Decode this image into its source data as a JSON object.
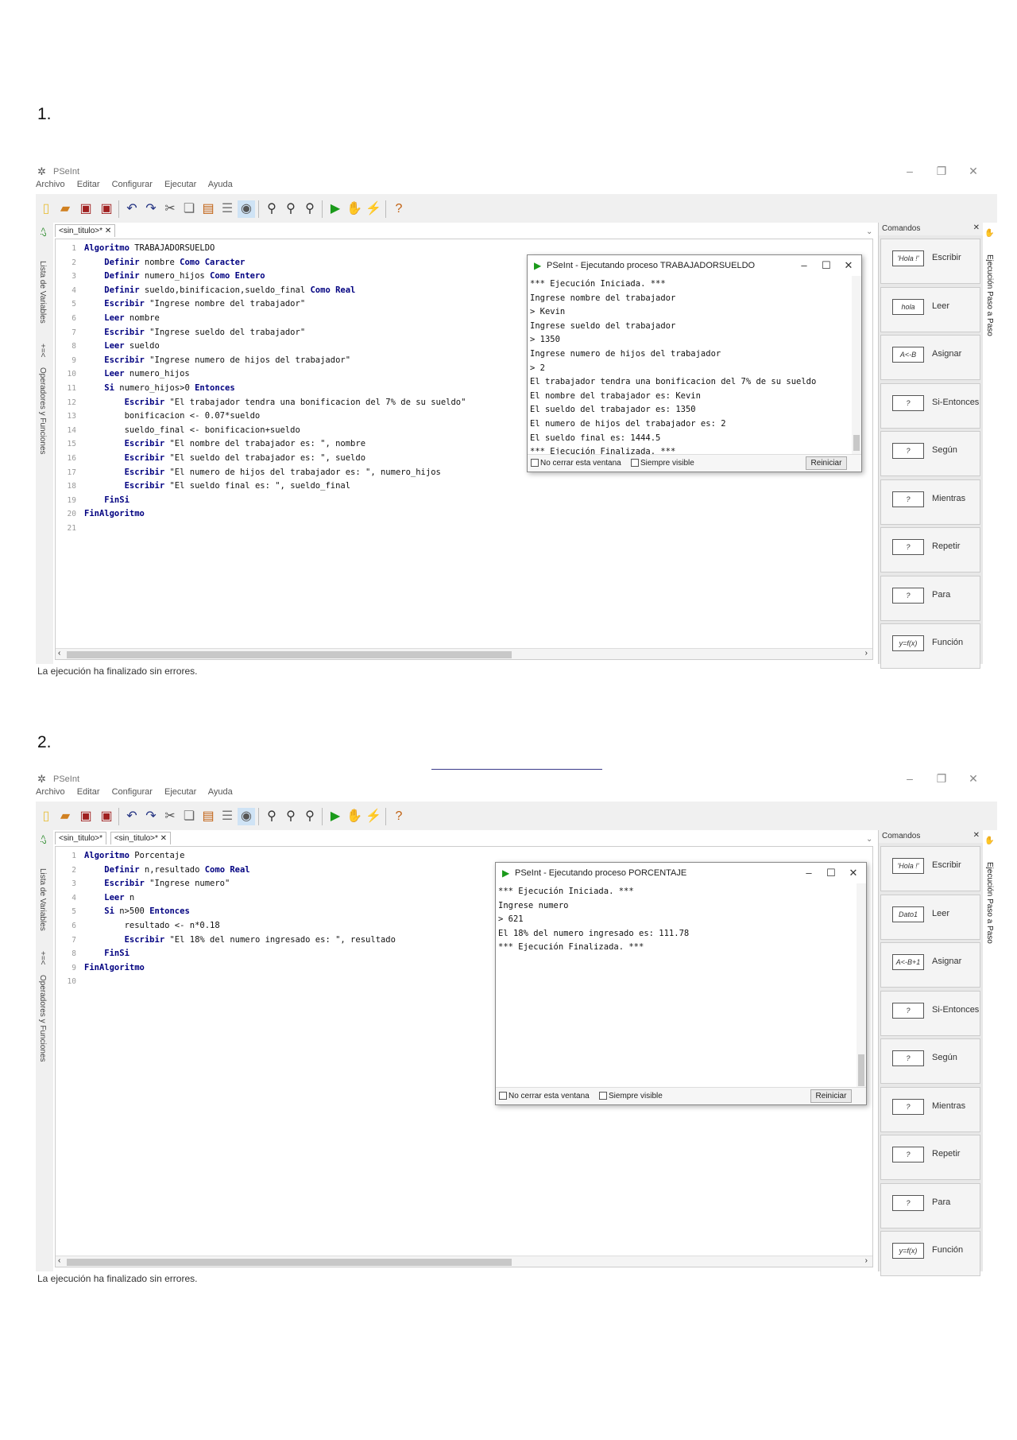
{
  "sections": [
    {
      "number": "1.",
      "window": {
        "app_name": "PSeInt",
        "menu": [
          "Archivo",
          "Editar",
          "Configurar",
          "Ejecutar",
          "Ayuda"
        ],
        "tabs": [
          "<sin_titulo>*"
        ],
        "left_panels": [
          "Lista de Variables",
          "Operadores y Funciones"
        ],
        "right_panel": "Ejecución Paso a Paso",
        "line_numbers": [
          "1",
          "2",
          "3",
          "4",
          "5",
          "6",
          "7",
          "8",
          "9",
          "10",
          "11",
          "12",
          "13",
          "14",
          "15",
          "16",
          "17",
          "18",
          "19",
          "20",
          "21"
        ],
        "code": [
          [
            {
              "t": "Algoritmo",
              "k": 1
            },
            {
              "t": " TRABAJADORSUELDO",
              "k": 0
            }
          ],
          [
            {
              "t": "    Definir",
              "k": 1
            },
            {
              "t": " nombre ",
              "k": 0
            },
            {
              "t": "Como Caracter",
              "k": 1
            }
          ],
          [
            {
              "t": "    Definir",
              "k": 1
            },
            {
              "t": " numero_hijos ",
              "k": 0
            },
            {
              "t": "Como Entero",
              "k": 1
            }
          ],
          [
            {
              "t": "    Definir",
              "k": 1
            },
            {
              "t": " sueldo,binificacion,sueldo_final ",
              "k": 0
            },
            {
              "t": "Como Real",
              "k": 1
            }
          ],
          [
            {
              "t": "    Escribir",
              "k": 1
            },
            {
              "t": " \"Ingrese nombre del trabajador\"",
              "k": 0
            }
          ],
          [
            {
              "t": "    Leer",
              "k": 1
            },
            {
              "t": " nombre",
              "k": 0
            }
          ],
          [
            {
              "t": "    Escribir",
              "k": 1
            },
            {
              "t": " \"Ingrese sueldo del trabajador\"",
              "k": 0
            }
          ],
          [
            {
              "t": "    Leer",
              "k": 1
            },
            {
              "t": " sueldo",
              "k": 0
            }
          ],
          [
            {
              "t": "    Escribir",
              "k": 1
            },
            {
              "t": " \"Ingrese numero de hijos del trabajador\"",
              "k": 0
            }
          ],
          [
            {
              "t": "    Leer",
              "k": 1
            },
            {
              "t": " numero_hijos",
              "k": 0
            }
          ],
          [
            {
              "t": "    Si",
              "k": 1
            },
            {
              "t": " numero_hijos>0 ",
              "k": 0
            },
            {
              "t": "Entonces",
              "k": 1
            }
          ],
          [
            {
              "t": "        Escribir",
              "k": 1
            },
            {
              "t": " \"El trabajador tendra una bonificacion del 7% de su sueldo\"",
              "k": 0
            }
          ],
          [
            {
              "t": "        bonificacion <- 0.07*sueldo",
              "k": 0
            }
          ],
          [
            {
              "t": "        sueldo_final <- bonificacion+sueldo",
              "k": 0
            }
          ],
          [
            {
              "t": "        Escribir",
              "k": 1
            },
            {
              "t": " \"El nombre del trabajador es: \", nombre",
              "k": 0
            }
          ],
          [
            {
              "t": "        Escribir",
              "k": 1
            },
            {
              "t": " \"El sueldo del trabajador es: \", sueldo",
              "k": 0
            }
          ],
          [
            {
              "t": "        Escribir",
              "k": 1
            },
            {
              "t": " \"El numero de hijos del trabajador es: \", numero_hijos",
              "k": 0
            }
          ],
          [
            {
              "t": "        Escribir",
              "k": 1
            },
            {
              "t": " \"El sueldo final es: \", sueldo_final",
              "k": 0
            }
          ],
          [
            {
              "t": "    FinSi",
              "k": 1
            }
          ],
          [
            {
              "t": "FinAlgoritmo",
              "k": 1
            }
          ],
          [
            {
              "t": "",
              "k": 0
            }
          ]
        ],
        "status": "La ejecución ha finalizado sin errores.",
        "commands_title": "Comandos",
        "commands": [
          {
            "icon": "'Hola !'",
            "label": "Escribir"
          },
          {
            "icon": "hola",
            "label": "Leer"
          },
          {
            "icon": "A<-B",
            "label": "Asignar"
          },
          {
            "icon": "? ",
            "label": "Si-Entonces"
          },
          {
            "icon": "? ",
            "label": "Según"
          },
          {
            "icon": "? ",
            "label": "Mientras"
          },
          {
            "icon": "? ",
            "label": "Repetir"
          },
          {
            "icon": "? ",
            "label": "Para"
          },
          {
            "icon": "y=f(x)",
            "label": "Función"
          }
        ],
        "console": {
          "title": "PSeInt - Ejecutando proceso TRABAJADORSUELDO",
          "lines": [
            "*** Ejecución Iniciada. ***",
            "Ingrese nombre del trabajador",
            "> Kevin",
            "Ingrese sueldo del trabajador",
            "> 1350",
            "Ingrese numero de hijos del trabajador",
            "> 2",
            "El trabajador tendra una bonificacion del 7% de su sueldo",
            "El nombre del trabajador es: Kevin",
            "El sueldo del trabajador es: 1350",
            "El numero de hijos del trabajador es: 2",
            "El sueldo final es: 1444.5",
            "*** Ejecución Finalizada. ***"
          ],
          "no_close": "No cerrar esta ventana",
          "always_visible": "Siempre visible",
          "restart": "Reiniciar"
        }
      }
    },
    {
      "number": "2.",
      "window": {
        "app_name": "PSeInt",
        "menu": [
          "Archivo",
          "Editar",
          "Configurar",
          "Ejecutar",
          "Ayuda"
        ],
        "tabs": [
          "<sin_titulo>*",
          "<sin_titulo>*"
        ],
        "left_panels": [
          "Lista de Variables",
          "Operadores y Funciones"
        ],
        "right_panel": "Ejecución Paso a Paso",
        "line_numbers": [
          "1",
          "2",
          "3",
          "4",
          "5",
          "6",
          "7",
          "8",
          "9",
          "10"
        ],
        "code": [
          [
            {
              "t": "Algoritmo",
              "k": 1
            },
            {
              "t": " Porcentaje",
              "k": 0
            }
          ],
          [
            {
              "t": "    Definir",
              "k": 1
            },
            {
              "t": " n,resultado ",
              "k": 0
            },
            {
              "t": "Como Real",
              "k": 1
            }
          ],
          [
            {
              "t": "    Escribir",
              "k": 1
            },
            {
              "t": " \"Ingrese numero\"",
              "k": 0
            }
          ],
          [
            {
              "t": "    Leer",
              "k": 1
            },
            {
              "t": " n",
              "k": 0
            }
          ],
          [
            {
              "t": "    Si",
              "k": 1
            },
            {
              "t": " n>500 ",
              "k": 0
            },
            {
              "t": "Entonces",
              "k": 1
            }
          ],
          [
            {
              "t": "        resultado <- n*0.18",
              "k": 0
            }
          ],
          [
            {
              "t": "        Escribir",
              "k": 1
            },
            {
              "t": " \"El 18% del numero ingresado es: \", resultado",
              "k": 0
            }
          ],
          [
            {
              "t": "    FinSi",
              "k": 1
            }
          ],
          [
            {
              "t": "FinAlgoritmo",
              "k": 1
            }
          ],
          [
            {
              "t": "",
              "k": 0
            }
          ]
        ],
        "status": "La ejecución ha finalizado sin errores.",
        "commands_title": "Comandos",
        "commands": [
          {
            "icon": "'Hola !'",
            "label": "Escribir"
          },
          {
            "icon": "Dato1",
            "label": "Leer"
          },
          {
            "icon": "A<-B+1",
            "label": "Asignar"
          },
          {
            "icon": "? ",
            "label": "Si-Entonces"
          },
          {
            "icon": "? ",
            "label": "Según"
          },
          {
            "icon": "? ",
            "label": "Mientras"
          },
          {
            "icon": "? ",
            "label": "Repetir"
          },
          {
            "icon": "? ",
            "label": "Para"
          },
          {
            "icon": "y=f(x)",
            "label": "Función"
          }
        ],
        "console": {
          "title": "PSeInt - Ejecutando proceso PORCENTAJE",
          "lines": [
            "*** Ejecución Iniciada. ***",
            "Ingrese numero",
            "> 621",
            "El 18% del numero ingresado es: 111.78",
            "*** Ejecución Finalizada. ***"
          ],
          "no_close": "No cerrar esta ventana",
          "always_visible": "Siempre visible",
          "restart": "Reiniciar"
        }
      }
    }
  ]
}
